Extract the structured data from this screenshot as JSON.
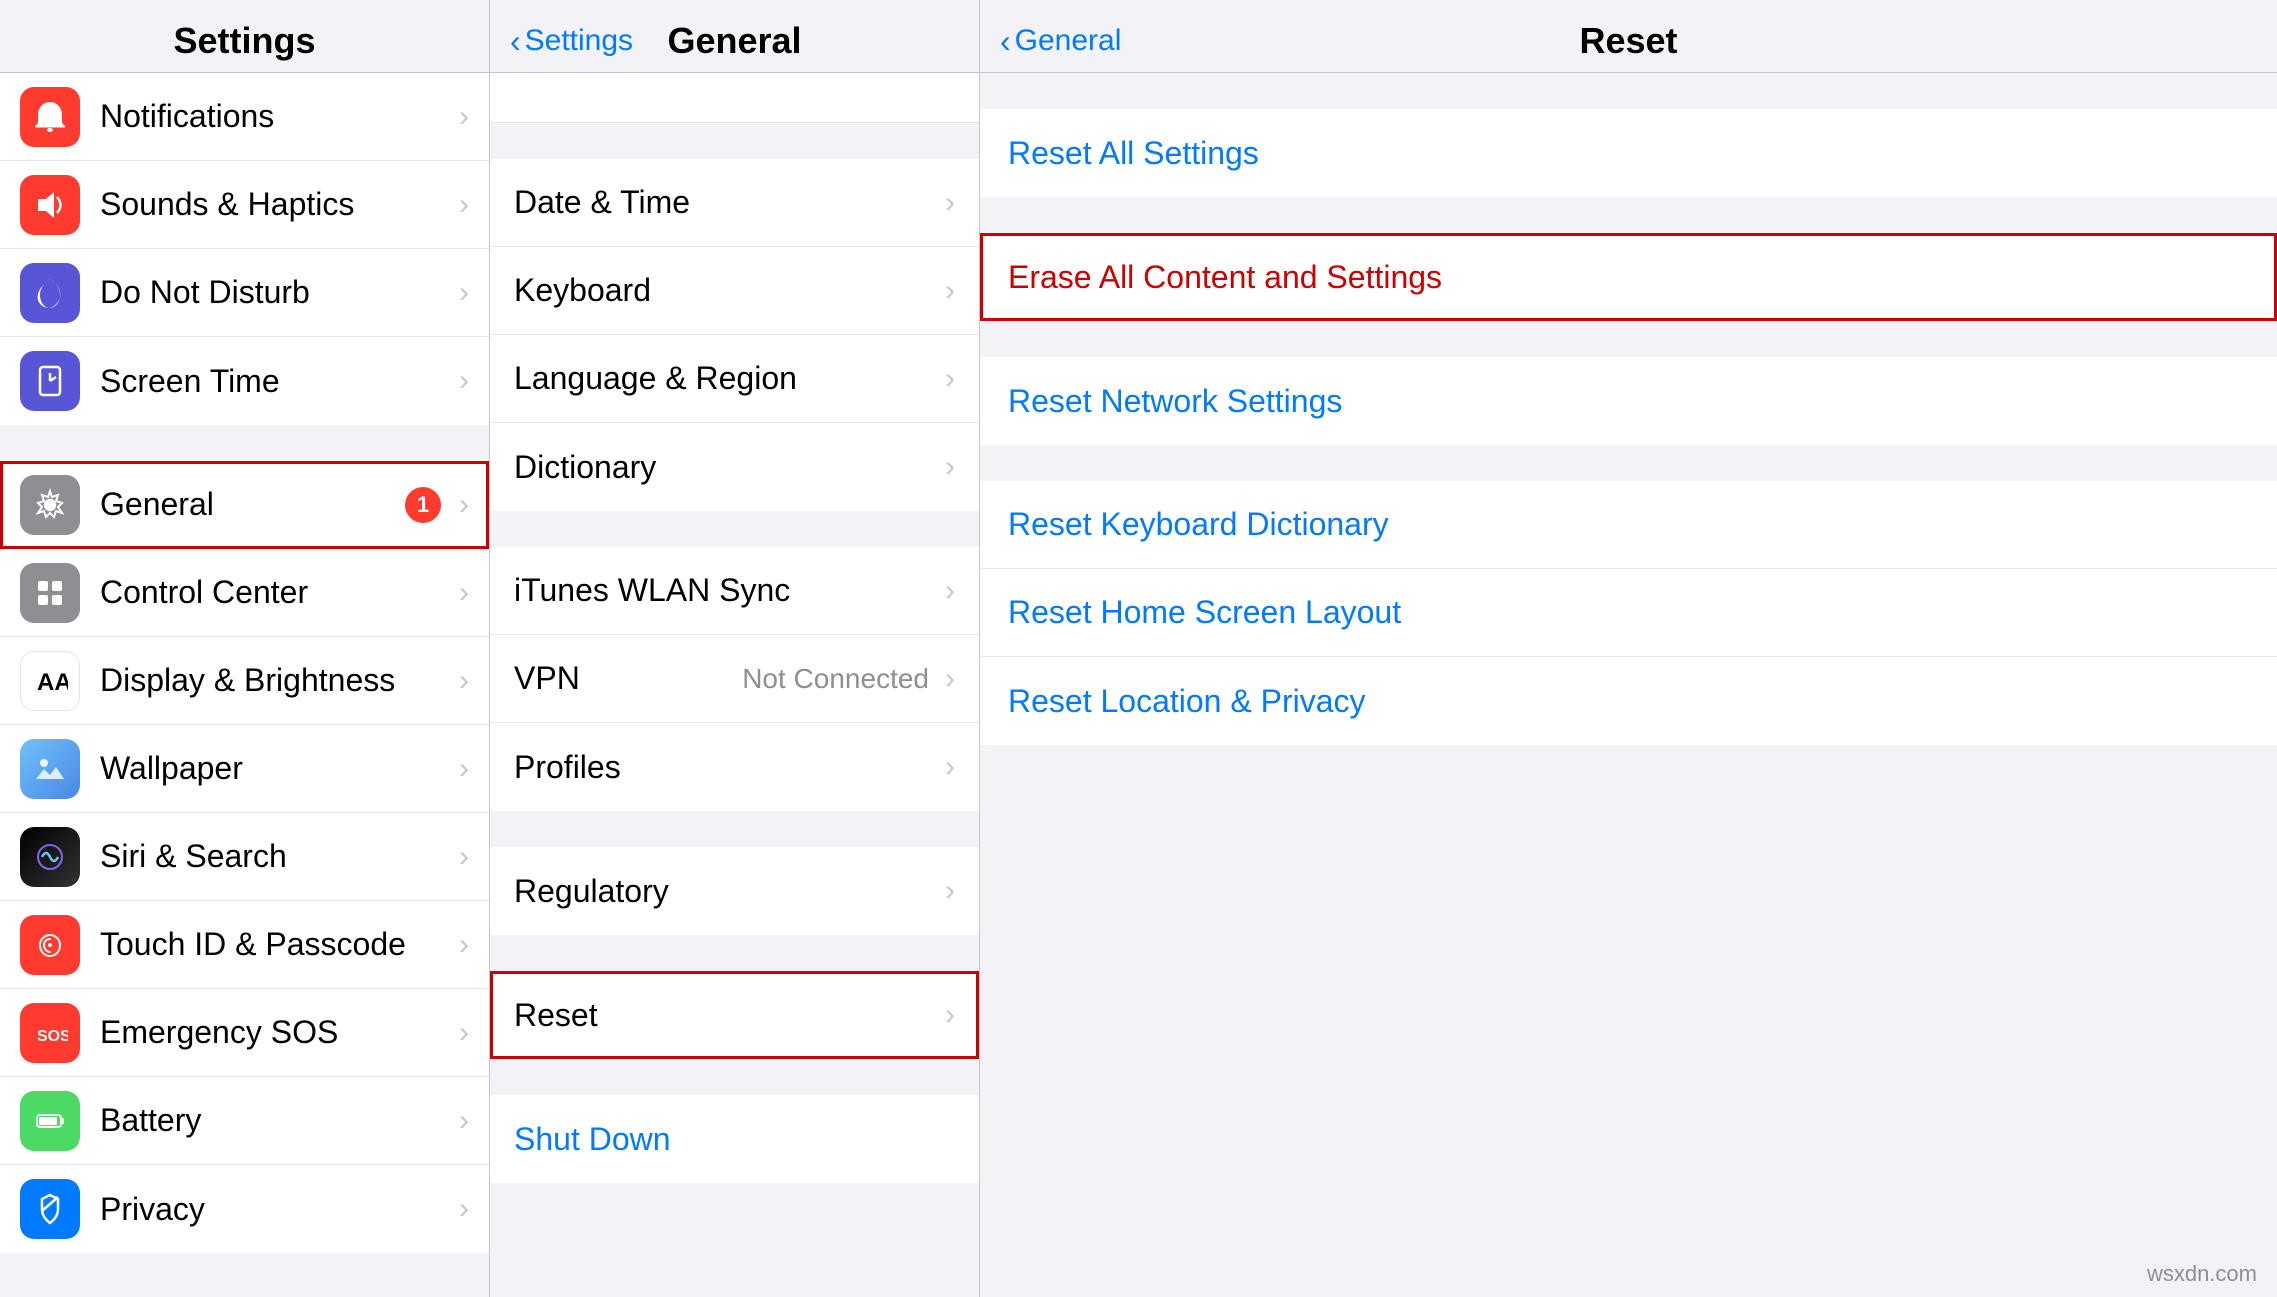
{
  "settings_column": {
    "title": "Settings",
    "items_group1": [
      {
        "id": "notifications",
        "label": "Notifications",
        "icon_class": "icon-notifications",
        "icon_type": "bell"
      },
      {
        "id": "sounds",
        "label": "Sounds & Haptics",
        "icon_class": "icon-sounds",
        "icon_type": "speaker"
      },
      {
        "id": "donotdisturb",
        "label": "Do Not Disturb",
        "icon_class": "icon-donotdisturb",
        "icon_type": "moon"
      },
      {
        "id": "screentime",
        "label": "Screen Time",
        "icon_class": "icon-screentime",
        "icon_type": "hourglass"
      }
    ],
    "items_group2": [
      {
        "id": "general",
        "label": "General",
        "icon_class": "icon-general",
        "icon_type": "gear",
        "badge": "1",
        "highlighted": true
      },
      {
        "id": "controlcenter",
        "label": "Control Center",
        "icon_class": "icon-controlcenter",
        "icon_type": "switches"
      },
      {
        "id": "displaybrightness",
        "label": "Display & Brightness",
        "icon_class": "icon-displaybrightness",
        "icon_type": "textAA"
      },
      {
        "id": "wallpaper",
        "label": "Wallpaper",
        "icon_class": "icon-wallpaper",
        "icon_type": "flower"
      },
      {
        "id": "siri",
        "label": "Siri & Search",
        "icon_class": "icon-siri",
        "icon_type": "siri"
      },
      {
        "id": "touchid",
        "label": "Touch ID & Passcode",
        "icon_class": "icon-touchid",
        "icon_type": "fingerprint"
      },
      {
        "id": "emergencysos",
        "label": "Emergency SOS",
        "icon_class": "icon-emergencysos",
        "icon_type": "sos"
      },
      {
        "id": "battery",
        "label": "Battery",
        "icon_class": "icon-battery",
        "icon_type": "battery"
      },
      {
        "id": "privacy",
        "label": "Privacy",
        "icon_class": "icon-privacy",
        "icon_type": "hand"
      }
    ]
  },
  "general_column": {
    "back_label": "Settings",
    "title": "General",
    "items_group1": [
      {
        "id": "datetime",
        "label": "Date & Time"
      },
      {
        "id": "keyboard",
        "label": "Keyboard"
      },
      {
        "id": "language",
        "label": "Language & Region"
      },
      {
        "id": "dictionary",
        "label": "Dictionary"
      }
    ],
    "items_group2": [
      {
        "id": "ituneswlan",
        "label": "iTunes WLAN Sync"
      },
      {
        "id": "vpn",
        "label": "VPN",
        "detail": "Not Connected"
      },
      {
        "id": "profiles",
        "label": "Profiles"
      }
    ],
    "items_group3": [
      {
        "id": "regulatory",
        "label": "Regulatory"
      }
    ],
    "items_group4": [
      {
        "id": "reset",
        "label": "Reset",
        "highlighted": true
      }
    ],
    "shutdown_label": "Shut Down"
  },
  "reset_column": {
    "back_label": "General",
    "title": "Reset",
    "items_group1": [
      {
        "id": "resetallsettings",
        "label": "Reset All Settings"
      }
    ],
    "items_group2": [
      {
        "id": "eraseallcontent",
        "label": "Erase All Content and Settings",
        "highlighted": true
      }
    ],
    "items_group3": [
      {
        "id": "resetnetwork",
        "label": "Reset Network Settings"
      }
    ],
    "items_group4": [
      {
        "id": "resetkeyboard",
        "label": "Reset Keyboard Dictionary"
      },
      {
        "id": "resethomescreen",
        "label": "Reset Home Screen Layout"
      },
      {
        "id": "resetlocation",
        "label": "Reset Location & Privacy"
      }
    ]
  },
  "watermark": "wsxdn.com",
  "accent_color": "#007aff",
  "highlight_color": "#cc0000"
}
